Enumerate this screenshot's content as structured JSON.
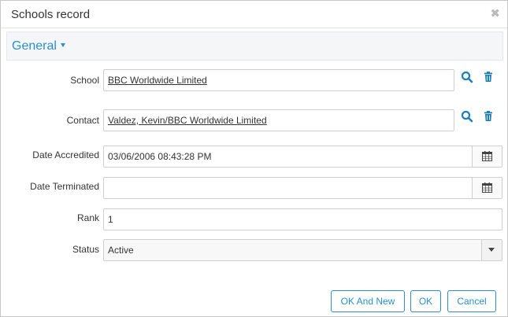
{
  "dialog": {
    "title": "Schools record",
    "close_glyph": "✖",
    "section": {
      "label": "General"
    }
  },
  "form": {
    "school": {
      "label": "School",
      "value": "BBC Worldwide Limited"
    },
    "contact": {
      "label": "Contact",
      "value": "Valdez, Kevin/BBC Worldwide Limited"
    },
    "date_accredited": {
      "label": "Date Accredited",
      "value": "03/06/2006 08:43:28 PM"
    },
    "date_terminated": {
      "label": "Date Terminated",
      "value": ""
    },
    "rank": {
      "label": "Rank",
      "value": "1"
    },
    "status": {
      "label": "Status",
      "value": "Active"
    }
  },
  "buttons": {
    "ok_and_new": "OK And New",
    "ok": "OK",
    "cancel": "Cancel"
  },
  "colors": {
    "accent": "#2a8fcf",
    "section_bg": "#f4f6f8",
    "border": "#cfcfcf"
  },
  "icons": {
    "lookup": "search-icon",
    "clear": "trash-icon",
    "calendar": "calendar-icon",
    "dropdown": "caret-down-icon",
    "close": "close-icon"
  }
}
